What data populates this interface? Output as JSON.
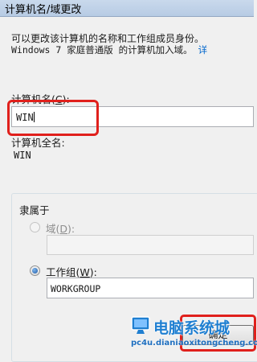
{
  "window": {
    "title": "计算机名/域更改"
  },
  "description": {
    "line1": "可以更改该计算机的名称和工作组成员身份。",
    "line2_prefix": "Windows 7 家庭普通版 的计算机加入域。",
    "line2_link": "详"
  },
  "computer_name": {
    "label_text": "计算机名(",
    "label_key": "C",
    "label_tail": "):",
    "value": "WIN"
  },
  "full_name": {
    "label": "计算机全名:",
    "value": "WIN"
  },
  "member_of": {
    "caption": "隶属于",
    "domain_label": "域(",
    "domain_key": "D",
    "domain_tail": "):",
    "domain_value": "",
    "workgroup_label": "工作组(",
    "workgroup_key": "W",
    "workgroup_tail": "):",
    "workgroup_value": "WORKGROUP",
    "selected": "workgroup"
  },
  "buttons": {
    "ok": "确定"
  },
  "watermark": {
    "title": "电脑系统城",
    "url": "pc4u.dianiaoxitongcheng.com"
  },
  "colors": {
    "highlight": "#e0201c",
    "link": "#0066cc",
    "accent": "#1f7fd1"
  },
  "icons": [
    "radio-button",
    "watermark-logo-icon"
  ]
}
